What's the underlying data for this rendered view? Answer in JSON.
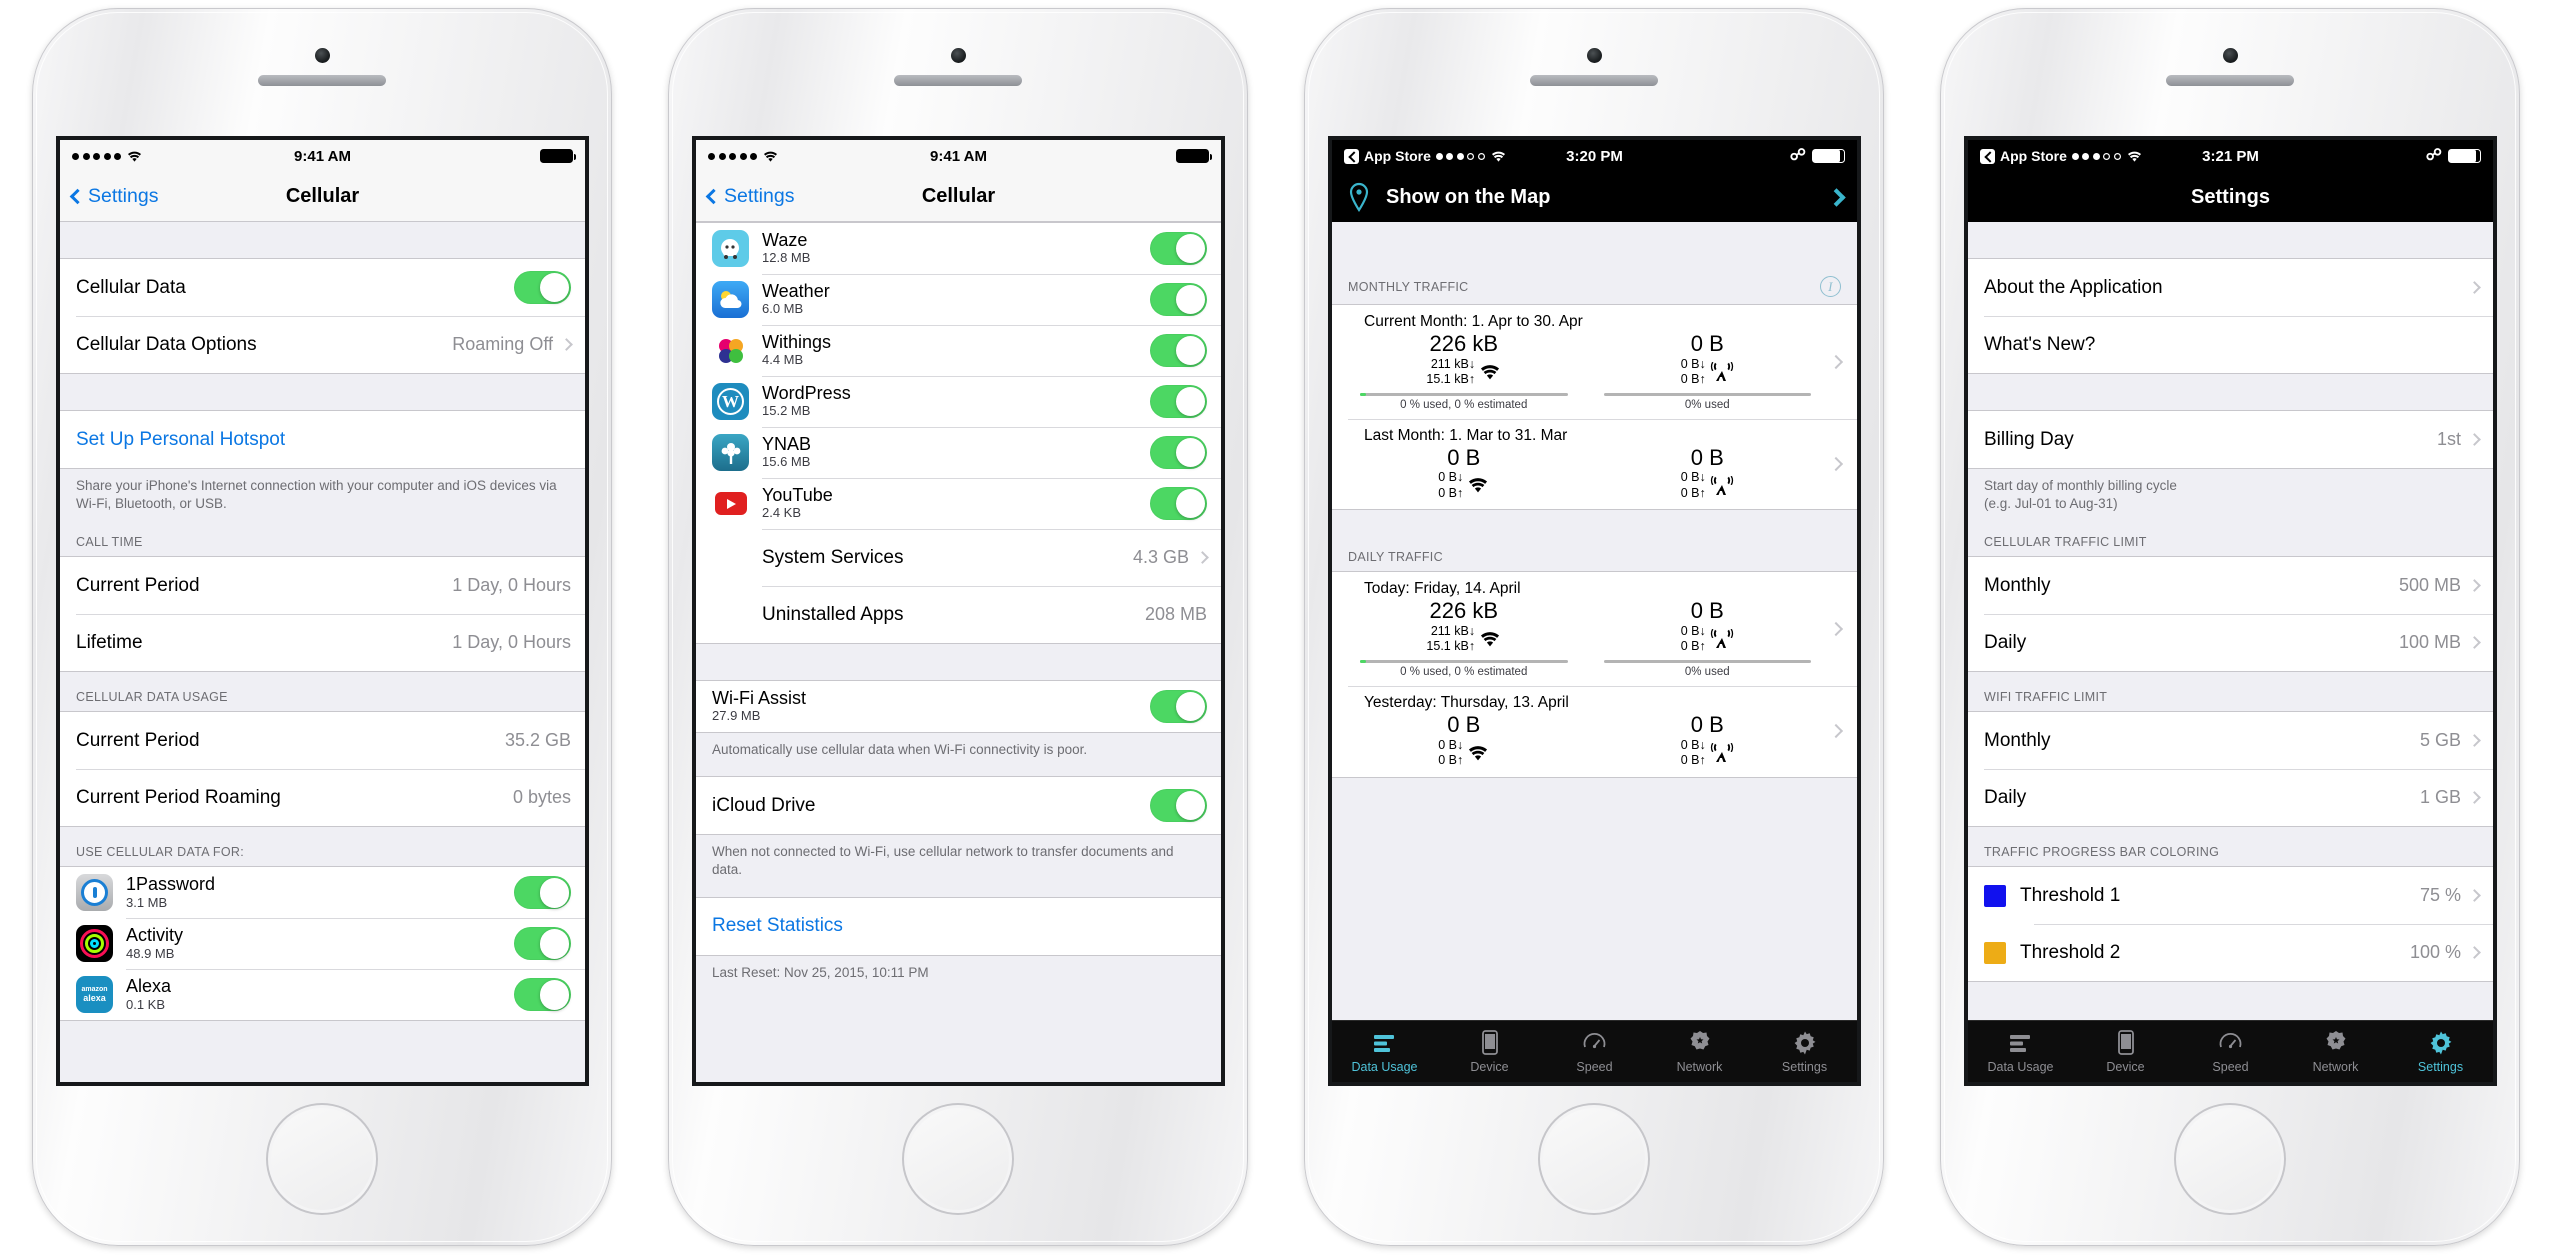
{
  "phones": [
    {
      "id": "phone-cellular-top",
      "statusbar": {
        "signal_dots": 5,
        "signal_filled": 5,
        "wifi": true,
        "time": "9:41 AM",
        "battery_pct": 100,
        "carrier_label": ""
      },
      "nav": {
        "back_label": "Settings",
        "title": "Cellular"
      },
      "sections": [
        {
          "type": "gap"
        },
        {
          "type": "group",
          "rows": [
            {
              "label": "Cellular Data",
              "control": "toggle",
              "on": true
            },
            {
              "label": "Cellular Data Options",
              "value": "Roaming Off",
              "chevron": true
            }
          ]
        },
        {
          "type": "gap"
        },
        {
          "type": "group",
          "rows": [
            {
              "label": "Set Up Personal Hotspot",
              "blue": true
            }
          ]
        },
        {
          "type": "footer",
          "text": "Share your iPhone's Internet connection with your computer and iOS devices via Wi-Fi, Bluetooth, or USB."
        },
        {
          "type": "header",
          "text": "CALL TIME"
        },
        {
          "type": "group",
          "rows": [
            {
              "label": "Current Period",
              "value": "1 Day, 0 Hours"
            },
            {
              "label": "Lifetime",
              "value": "1 Day, 0 Hours"
            }
          ]
        },
        {
          "type": "header",
          "text": "CELLULAR DATA USAGE"
        },
        {
          "type": "group",
          "rows": [
            {
              "label": "Current Period",
              "value": "35.2 GB"
            },
            {
              "label": "Current Period Roaming",
              "value": "0 bytes"
            }
          ]
        },
        {
          "type": "header",
          "text": "USE CELLULAR DATA FOR:"
        },
        {
          "type": "apps",
          "rows": [
            {
              "name": "1Password",
              "size": "3.1 MB",
              "icon": "1password-icon",
              "on": true
            },
            {
              "name": "Activity",
              "size": "48.9 MB",
              "icon": "activity-icon",
              "on": true
            },
            {
              "name": "Alexa",
              "size": "0.1 KB",
              "icon": "alexa-icon",
              "on": true
            }
          ]
        }
      ]
    },
    {
      "id": "phone-cellular-bottom",
      "statusbar": {
        "signal_dots": 5,
        "signal_filled": 5,
        "wifi": true,
        "time": "9:41 AM",
        "battery_pct": 100
      },
      "nav": {
        "back_label": "Settings",
        "title": "Cellular"
      },
      "apps": [
        {
          "name": "Waze",
          "size": "12.8 MB",
          "icon": "waze-icon",
          "on": true
        },
        {
          "name": "Weather",
          "size": "6.0 MB",
          "icon": "weather-icon",
          "on": true
        },
        {
          "name": "Withings",
          "size": "4.4 MB",
          "icon": "withings-icon",
          "on": true
        },
        {
          "name": "WordPress",
          "size": "15.2 MB",
          "icon": "wordpress-icon",
          "on": true
        },
        {
          "name": "YNAB",
          "size": "15.6 MB",
          "icon": "ynab-icon",
          "on": true
        },
        {
          "name": "YouTube",
          "size": "2.4 KB",
          "icon": "youtube-icon",
          "on": true
        }
      ],
      "system_rows": [
        {
          "label": "System Services",
          "value": "4.3 GB",
          "chevron": true
        },
        {
          "label": "Uninstalled Apps",
          "value": "208 MB"
        }
      ],
      "wifi_assist": {
        "label": "Wi-Fi Assist",
        "size": "27.9 MB",
        "on": true,
        "footer": "Automatically use cellular data when Wi-Fi connectivity is poor."
      },
      "icloud_drive": {
        "label": "iCloud Drive",
        "on": true,
        "footer": "When not connected to Wi-Fi, use cellular network to transfer documents and data."
      },
      "reset": {
        "label": "Reset Statistics",
        "footer": "Last Reset: Nov 25, 2015, 10:11 PM"
      }
    },
    {
      "id": "phone-data-usage",
      "statusbar": {
        "back_app": "App Store",
        "signal_dots": 5,
        "signal_filled": 3,
        "wifi": true,
        "time": "3:20 PM",
        "bluetooth": true,
        "battery_pct": 88
      },
      "nav": {
        "title": "Show on the Map",
        "icon": "map-pin-icon"
      },
      "monthly": {
        "header": "MONTHLY TRAFFIC",
        "rows": [
          {
            "period": "Current Month: 1. Apr to 30. Apr",
            "wifi": {
              "total": "226 kB",
              "down": "211 kB",
              "up": "15.1 kB",
              "bar_pct": 3,
              "used": "0 % used, 0 % estimated"
            },
            "cell": {
              "total": "0 B",
              "down": "0 B",
              "up": "0 B",
              "bar_pct": 0,
              "used": "0% used"
            }
          },
          {
            "period": "Last Month: 1. Mar to 31. Mar",
            "wifi": {
              "total": "0 B",
              "down": "0 B",
              "up": "0 B"
            },
            "cell": {
              "total": "0 B",
              "down": "0 B",
              "up": "0 B"
            }
          }
        ]
      },
      "daily": {
        "header": "DAILY TRAFFIC",
        "rows": [
          {
            "period": "Today: Friday, 14. April",
            "wifi": {
              "total": "226 kB",
              "down": "211 kB",
              "up": "15.1 kB",
              "bar_pct": 3,
              "used": "0 % used, 0 % estimated"
            },
            "cell": {
              "total": "0 B",
              "down": "0 B",
              "up": "0 B",
              "bar_pct": 0,
              "used": "0% used"
            }
          },
          {
            "period": "Yesterday: Thursday, 13. April",
            "wifi": {
              "total": "0 B",
              "down": "0 B",
              "up": "0 B"
            },
            "cell": {
              "total": "0 B",
              "down": "0 B",
              "up": "0 B"
            }
          }
        ]
      },
      "tabs": [
        {
          "label": "Data Usage",
          "icon": "bars-icon",
          "active": true
        },
        {
          "label": "Device",
          "icon": "phone-icon",
          "active": false
        },
        {
          "label": "Speed",
          "icon": "gauge-icon",
          "active": false
        },
        {
          "label": "Network",
          "icon": "badge-icon",
          "active": false
        },
        {
          "label": "Settings",
          "icon": "gear-icon",
          "active": false
        }
      ]
    },
    {
      "id": "phone-app-settings",
      "statusbar": {
        "back_app": "App Store",
        "signal_dots": 5,
        "signal_filled": 3,
        "wifi": true,
        "time": "3:21 PM",
        "bluetooth": true,
        "battery_pct": 88
      },
      "nav": {
        "title": "Settings"
      },
      "sections": [
        {
          "type": "gap"
        },
        {
          "type": "group",
          "rows": [
            {
              "label": "About the Application",
              "chevron": true
            },
            {
              "label": "What's New?",
              "chevron": false
            }
          ]
        },
        {
          "type": "gap"
        },
        {
          "type": "group",
          "rows": [
            {
              "label": "Billing Day",
              "value": "1st",
              "chevron": true
            }
          ]
        },
        {
          "type": "footer",
          "text": "Start day of monthly billing cycle\n(e.g. Jul-01 to Aug-31)"
        },
        {
          "type": "header",
          "text": "CELLULAR TRAFFIC LIMIT"
        },
        {
          "type": "group",
          "rows": [
            {
              "label": "Monthly",
              "value": "500 MB",
              "chevron": true
            },
            {
              "label": "Daily",
              "value": "100 MB",
              "chevron": true
            }
          ]
        },
        {
          "type": "header",
          "text": "WIFI TRAFFIC LIMIT"
        },
        {
          "type": "group",
          "rows": [
            {
              "label": "Monthly",
              "value": "5 GB",
              "chevron": true
            },
            {
              "label": "Daily",
              "value": "1 GB",
              "chevron": true
            }
          ]
        },
        {
          "type": "header",
          "text": "TRAFFIC PROGRESS BAR COLORING"
        },
        {
          "type": "group",
          "rows": [
            {
              "label": "Threshold 1",
              "value": "75 %",
              "chevron": true,
              "swatch": "#1111ee"
            },
            {
              "label": "Threshold 2",
              "value": "100 %",
              "chevron": true,
              "swatch": "#edac16"
            }
          ]
        }
      ],
      "tabs": [
        {
          "label": "Data Usage",
          "icon": "bars-icon",
          "active": false
        },
        {
          "label": "Device",
          "icon": "phone-icon",
          "active": false
        },
        {
          "label": "Speed",
          "icon": "gauge-icon",
          "active": false
        },
        {
          "label": "Network",
          "icon": "badge-icon",
          "active": false
        },
        {
          "label": "Settings",
          "icon": "gear-icon",
          "active": true
        }
      ]
    }
  ],
  "colors": {
    "ios_blue": "#0b77e3",
    "toggle_green": "#4cd763",
    "teal": "#4fc3d9",
    "threshold1": "#1111ee",
    "threshold2": "#edac16"
  }
}
